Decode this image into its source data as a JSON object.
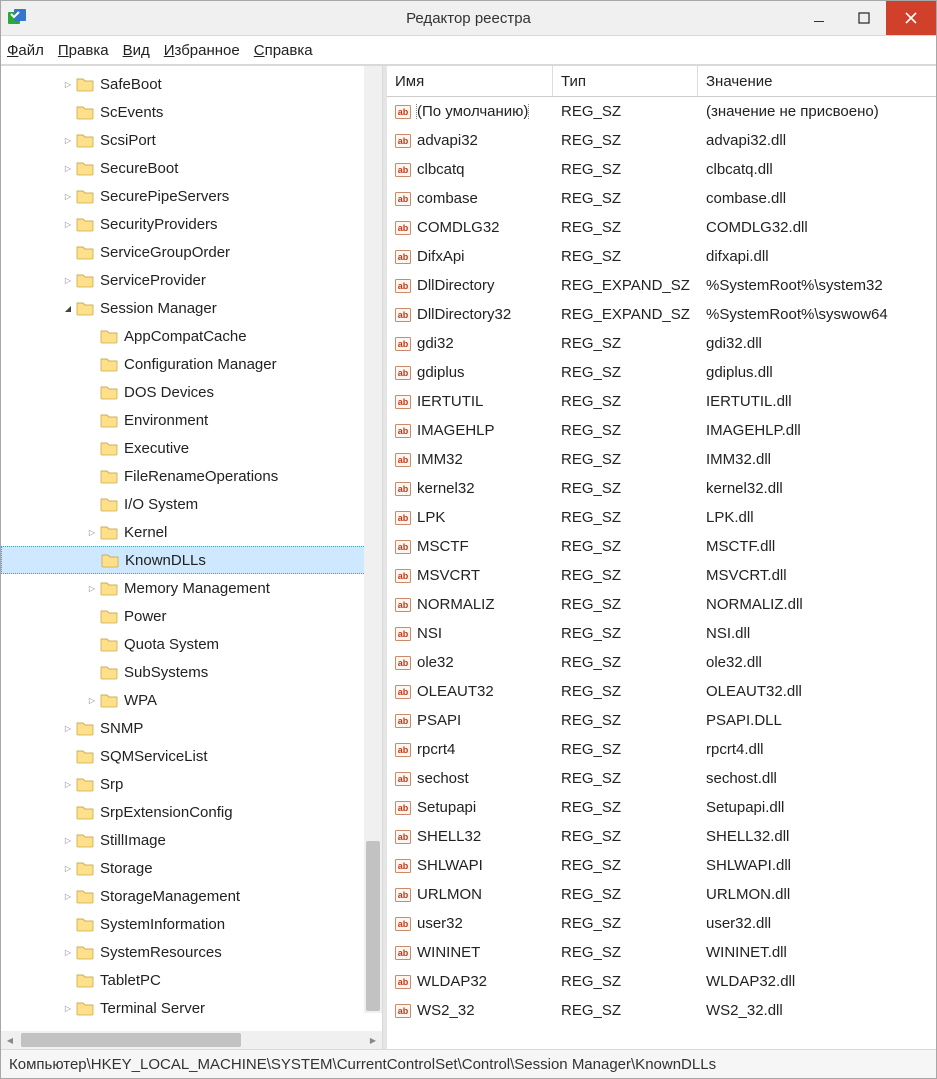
{
  "window": {
    "title": "Редактор реестра"
  },
  "menubar": {
    "file": {
      "accel": "Ф",
      "rest": "айл"
    },
    "edit": {
      "accel": "П",
      "rest": "равка"
    },
    "view": {
      "accel": "В",
      "rest": "ид"
    },
    "fav": {
      "accel": "И",
      "rest": "збранное"
    },
    "help": {
      "accel": "С",
      "rest": "правка"
    }
  },
  "tree": {
    "items": [
      {
        "label": "SafeBoot",
        "depth": 3,
        "expandable": true,
        "expanded": false
      },
      {
        "label": "ScEvents",
        "depth": 3,
        "expandable": false,
        "expanded": false
      },
      {
        "label": "ScsiPort",
        "depth": 3,
        "expandable": true,
        "expanded": false
      },
      {
        "label": "SecureBoot",
        "depth": 3,
        "expandable": true,
        "expanded": false
      },
      {
        "label": "SecurePipeServers",
        "depth": 3,
        "expandable": true,
        "expanded": false
      },
      {
        "label": "SecurityProviders",
        "depth": 3,
        "expandable": true,
        "expanded": false
      },
      {
        "label": "ServiceGroupOrder",
        "depth": 3,
        "expandable": false,
        "expanded": false
      },
      {
        "label": "ServiceProvider",
        "depth": 3,
        "expandable": true,
        "expanded": false
      },
      {
        "label": "Session Manager",
        "depth": 3,
        "expandable": true,
        "expanded": true
      },
      {
        "label": "AppCompatCache",
        "depth": 4,
        "expandable": false,
        "expanded": false
      },
      {
        "label": "Configuration Manager",
        "depth": 4,
        "expandable": false,
        "expanded": false
      },
      {
        "label": "DOS Devices",
        "depth": 4,
        "expandable": false,
        "expanded": false
      },
      {
        "label": "Environment",
        "depth": 4,
        "expandable": false,
        "expanded": false
      },
      {
        "label": "Executive",
        "depth": 4,
        "expandable": false,
        "expanded": false
      },
      {
        "label": "FileRenameOperations",
        "depth": 4,
        "expandable": false,
        "expanded": false
      },
      {
        "label": "I/O System",
        "depth": 4,
        "expandable": false,
        "expanded": false
      },
      {
        "label": "Kernel",
        "depth": 4,
        "expandable": true,
        "expanded": false
      },
      {
        "label": "KnownDLLs",
        "depth": 4,
        "expandable": false,
        "expanded": false,
        "selected": true
      },
      {
        "label": "Memory Management",
        "depth": 4,
        "expandable": true,
        "expanded": false
      },
      {
        "label": "Power",
        "depth": 4,
        "expandable": false,
        "expanded": false
      },
      {
        "label": "Quota System",
        "depth": 4,
        "expandable": false,
        "expanded": false
      },
      {
        "label": "SubSystems",
        "depth": 4,
        "expandable": false,
        "expanded": false
      },
      {
        "label": "WPA",
        "depth": 4,
        "expandable": true,
        "expanded": false
      },
      {
        "label": "SNMP",
        "depth": 3,
        "expandable": true,
        "expanded": false
      },
      {
        "label": "SQMServiceList",
        "depth": 3,
        "expandable": false,
        "expanded": false
      },
      {
        "label": "Srp",
        "depth": 3,
        "expandable": true,
        "expanded": false
      },
      {
        "label": "SrpExtensionConfig",
        "depth": 3,
        "expandable": false,
        "expanded": false
      },
      {
        "label": "StillImage",
        "depth": 3,
        "expandable": true,
        "expanded": false
      },
      {
        "label": "Storage",
        "depth": 3,
        "expandable": true,
        "expanded": false
      },
      {
        "label": "StorageManagement",
        "depth": 3,
        "expandable": true,
        "expanded": false
      },
      {
        "label": "SystemInformation",
        "depth": 3,
        "expandable": false,
        "expanded": false
      },
      {
        "label": "SystemResources",
        "depth": 3,
        "expandable": true,
        "expanded": false
      },
      {
        "label": "TabletPC",
        "depth": 3,
        "expandable": false,
        "expanded": false
      },
      {
        "label": "Terminal Server",
        "depth": 3,
        "expandable": true,
        "expanded": false
      }
    ]
  },
  "value_columns": {
    "name_label": "Имя",
    "type_label": "Тип",
    "value_label": "Значение"
  },
  "values": [
    {
      "name": "(По умолчанию)",
      "type": "REG_SZ",
      "value": "(значение не присвоено)",
      "selected": true
    },
    {
      "name": "advapi32",
      "type": "REG_SZ",
      "value": "advapi32.dll"
    },
    {
      "name": "clbcatq",
      "type": "REG_SZ",
      "value": "clbcatq.dll"
    },
    {
      "name": "combase",
      "type": "REG_SZ",
      "value": "combase.dll"
    },
    {
      "name": "COMDLG32",
      "type": "REG_SZ",
      "value": "COMDLG32.dll"
    },
    {
      "name": "DifxApi",
      "type": "REG_SZ",
      "value": "difxapi.dll"
    },
    {
      "name": "DllDirectory",
      "type": "REG_EXPAND_SZ",
      "value": "%SystemRoot%\\system32"
    },
    {
      "name": "DllDirectory32",
      "type": "REG_EXPAND_SZ",
      "value": "%SystemRoot%\\syswow64"
    },
    {
      "name": "gdi32",
      "type": "REG_SZ",
      "value": "gdi32.dll"
    },
    {
      "name": "gdiplus",
      "type": "REG_SZ",
      "value": "gdiplus.dll"
    },
    {
      "name": "IERTUTIL",
      "type": "REG_SZ",
      "value": "IERTUTIL.dll"
    },
    {
      "name": "IMAGEHLP",
      "type": "REG_SZ",
      "value": "IMAGEHLP.dll"
    },
    {
      "name": "IMM32",
      "type": "REG_SZ",
      "value": "IMM32.dll"
    },
    {
      "name": "kernel32",
      "type": "REG_SZ",
      "value": "kernel32.dll"
    },
    {
      "name": "LPK",
      "type": "REG_SZ",
      "value": "LPK.dll"
    },
    {
      "name": "MSCTF",
      "type": "REG_SZ",
      "value": "MSCTF.dll"
    },
    {
      "name": "MSVCRT",
      "type": "REG_SZ",
      "value": "MSVCRT.dll"
    },
    {
      "name": "NORMALIZ",
      "type": "REG_SZ",
      "value": "NORMALIZ.dll"
    },
    {
      "name": "NSI",
      "type": "REG_SZ",
      "value": "NSI.dll"
    },
    {
      "name": "ole32",
      "type": "REG_SZ",
      "value": "ole32.dll"
    },
    {
      "name": "OLEAUT32",
      "type": "REG_SZ",
      "value": "OLEAUT32.dll"
    },
    {
      "name": "PSAPI",
      "type": "REG_SZ",
      "value": "PSAPI.DLL"
    },
    {
      "name": "rpcrt4",
      "type": "REG_SZ",
      "value": "rpcrt4.dll"
    },
    {
      "name": "sechost",
      "type": "REG_SZ",
      "value": "sechost.dll"
    },
    {
      "name": "Setupapi",
      "type": "REG_SZ",
      "value": "Setupapi.dll"
    },
    {
      "name": "SHELL32",
      "type": "REG_SZ",
      "value": "SHELL32.dll"
    },
    {
      "name": "SHLWAPI",
      "type": "REG_SZ",
      "value": "SHLWAPI.dll"
    },
    {
      "name": "URLMON",
      "type": "REG_SZ",
      "value": "URLMON.dll"
    },
    {
      "name": "user32",
      "type": "REG_SZ",
      "value": "user32.dll"
    },
    {
      "name": "WININET",
      "type": "REG_SZ",
      "value": "WININET.dll"
    },
    {
      "name": "WLDAP32",
      "type": "REG_SZ",
      "value": "WLDAP32.dll"
    },
    {
      "name": "WS2_32",
      "type": "REG_SZ",
      "value": "WS2_32.dll"
    }
  ],
  "statusbar": {
    "path": "Компьютер\\HKEY_LOCAL_MACHINE\\SYSTEM\\CurrentControlSet\\Control\\Session Manager\\KnownDLLs"
  }
}
